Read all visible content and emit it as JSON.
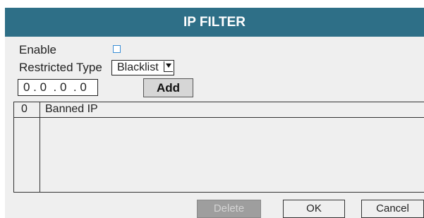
{
  "dialog": {
    "title": "IP FILTER"
  },
  "form": {
    "enable_label": "Enable",
    "enable_checked": false,
    "restricted_type_label": "Restricted Type",
    "restricted_type_value": "Blacklist",
    "ip_value": "0 . 0  . 0  . 0",
    "add_label": "Add"
  },
  "table": {
    "columns": [
      "0",
      "Banned IP"
    ],
    "rows": []
  },
  "footer": {
    "delete_label": "Delete",
    "delete_enabled": false,
    "ok_label": "OK",
    "cancel_label": "Cancel"
  },
  "colors": {
    "title_bar": "#2e6f87",
    "dialog_bg": "#efefef",
    "checkbox_border": "#3a8ed6"
  },
  "icons": {
    "select_arrow": "dropdown-arrow-icon"
  }
}
